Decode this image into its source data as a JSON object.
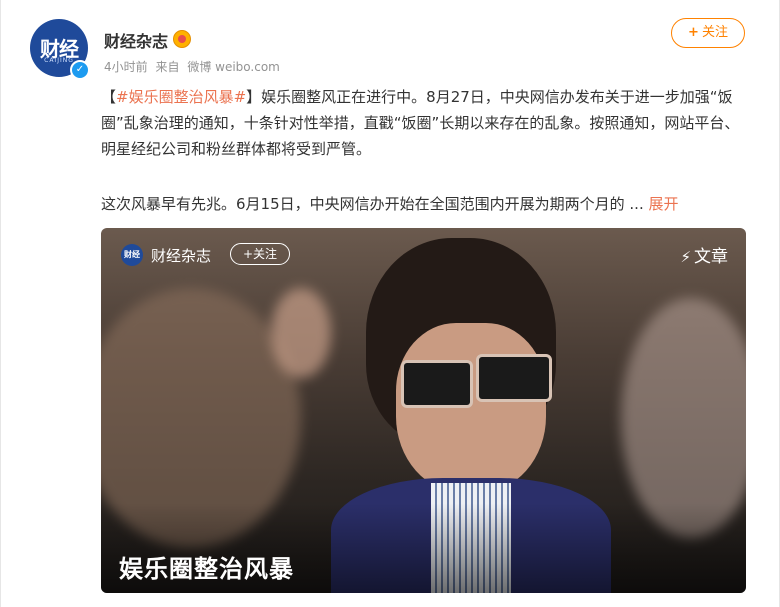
{
  "post": {
    "author": "财经杂志",
    "avatar_text": "财经",
    "avatar_sub": "CAIJING",
    "time": "4小时前",
    "source_prefix": "来自",
    "source": "微博 weibo.com",
    "follow_label": "关注",
    "follow_plus": "+",
    "bracket_open": "【",
    "hashtag": "#娱乐圈整治风暴#",
    "bracket_close": "】",
    "para1_rest": "娱乐圈整风正在进行中。8月27日，中央网信办发布关于进一步加强“饭圈”乱象治理的通知，十条针对性举措，直戳“饭圈”长期以来存在的乱象。按照通知，网站平台、明星经纪公司和粉丝群体都将受到严管。",
    "para2": "这次风暴早有先兆。6月15日，中央网信办开始在全国范围内开展为期两个月的",
    "ellipsis": " ... ",
    "expand_label": "展开"
  },
  "article_card": {
    "avatar_text": "财经",
    "author": "财经杂志",
    "follow_label": "关注",
    "follow_plus": "+",
    "article_label": "文章",
    "article_icon": "lightning-icon",
    "title": "娱乐圈整治风暴"
  },
  "colors": {
    "accent": "#ff8200",
    "link": "#eb7350",
    "brand": "#1f4a9a"
  }
}
